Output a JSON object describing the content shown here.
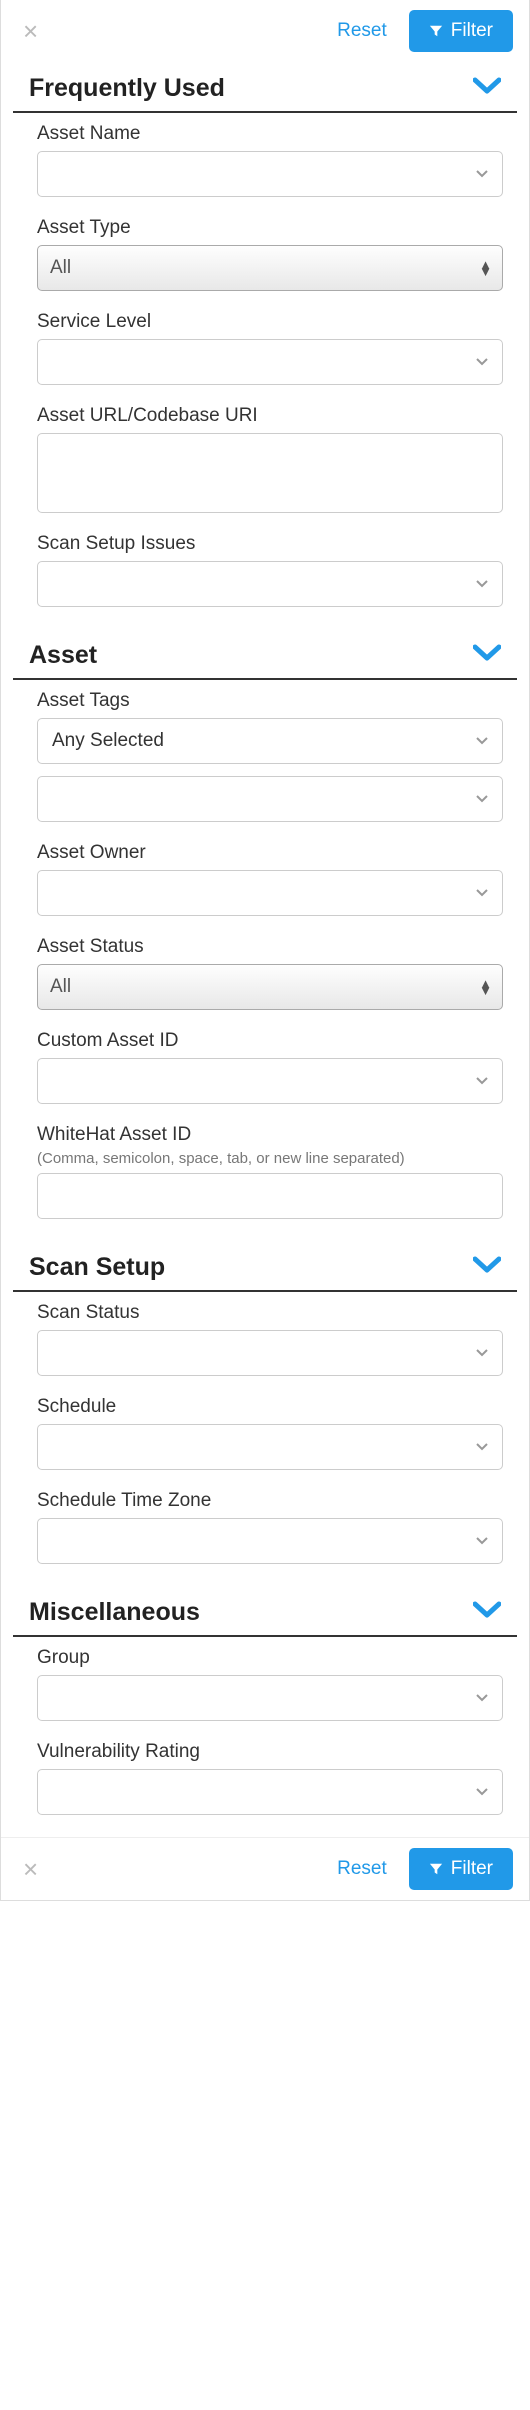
{
  "toolbar_top": {
    "reset": "Reset",
    "filter": "Filter"
  },
  "toolbar_bottom": {
    "reset": "Reset",
    "filter": "Filter"
  },
  "sections": {
    "freq": {
      "title": "Frequently Used",
      "asset_name_label": "Asset Name",
      "asset_name_value": "",
      "asset_type_label": "Asset Type",
      "asset_type_value": "All",
      "service_level_label": "Service Level",
      "service_level_value": "",
      "asset_url_label": "Asset URL/Codebase URI",
      "asset_url_value": "",
      "scan_setup_issues_label": "Scan Setup Issues",
      "scan_setup_issues_value": ""
    },
    "asset": {
      "title": "Asset",
      "asset_tags_label": "Asset Tags",
      "asset_tags_mode": "Any Selected",
      "asset_tags_value": "",
      "asset_owner_label": "Asset Owner",
      "asset_owner_value": "",
      "asset_status_label": "Asset Status",
      "asset_status_value": "All",
      "custom_asset_id_label": "Custom Asset ID",
      "custom_asset_id_value": "",
      "whitehat_asset_id_label": "WhiteHat Asset ID",
      "whitehat_asset_id_hint": "(Comma, semicolon, space, tab, or new line separated)",
      "whitehat_asset_id_value": ""
    },
    "scan": {
      "title": "Scan Setup",
      "scan_status_label": "Scan Status",
      "scan_status_value": "",
      "schedule_label": "Schedule",
      "schedule_value": "",
      "schedule_tz_label": "Schedule Time Zone",
      "schedule_tz_value": ""
    },
    "misc": {
      "title": "Miscellaneous",
      "group_label": "Group",
      "group_value": "",
      "vuln_rating_label": "Vulnerability Rating",
      "vuln_rating_value": ""
    }
  },
  "colors": {
    "accent": "#2199e8"
  }
}
